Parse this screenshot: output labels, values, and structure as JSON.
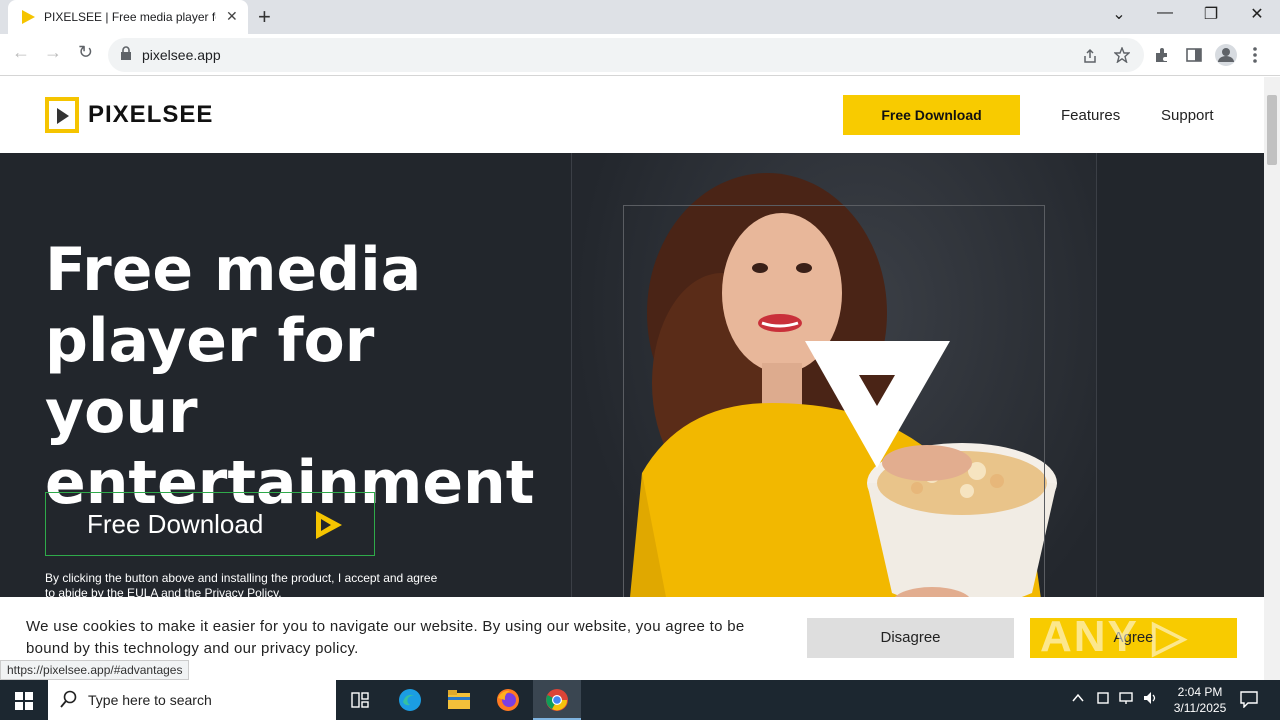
{
  "browser": {
    "tab_title": "PIXELSEE | Free media player for",
    "tab_close": "✕",
    "new_tab": "+",
    "url": "pixelsee.app",
    "window_controls": [
      "⌄",
      "—",
      "❐",
      "✕"
    ],
    "nav": {
      "back": "←",
      "forward": "→",
      "reload": "↻"
    },
    "toolbar_icons": [
      "share-icon",
      "bookmark-star-icon",
      "extensions-icon",
      "sidepanel-icon",
      "profile-icon",
      "menu-icon"
    ],
    "status_url": "https://pixelsee.app/#advantages"
  },
  "site": {
    "logo_text": "PIXELSEE",
    "header_download": "Free Download",
    "nav_links": [
      "Features",
      "Support"
    ],
    "hero_title": "Free media player for your entertainment",
    "hero_button": "Free Download",
    "hero_note": "By clicking the button above and installing the product, I accept and agree to abide by the EULA and the Privacy Policy.",
    "accent_color": "#f8cb00"
  },
  "cookie": {
    "text": "We use cookies to make it easier for you to navigate our website. By using our website, you agree to be bound by this technology and our privacy policy.",
    "disagree": "Disagree",
    "agree": "Agree"
  },
  "watermark": "ANY ▷ RUN",
  "taskbar": {
    "search_placeholder": "Type here to search",
    "time": "2:04 PM",
    "date": "3/11/2025"
  }
}
